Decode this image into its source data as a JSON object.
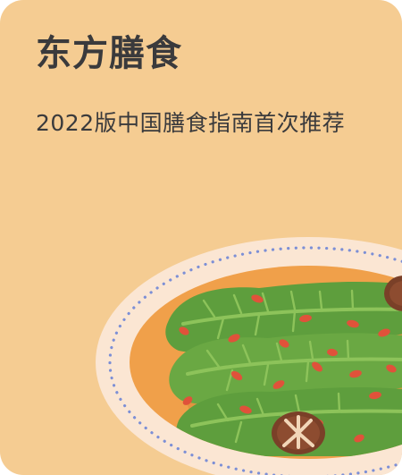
{
  "card": {
    "title": "东方膳食",
    "subtitle": "2022版中国膳食指南首次推荐"
  },
  "illustration": {
    "icon": "vegetable-dish-icon",
    "colors": {
      "background": "#f5cc92",
      "plate": "#fbe6d3",
      "plate_dots": "#7c8fd6",
      "sauce": "#f0a04a",
      "leaf": "#5e9e3d",
      "leaf_light": "#8dc35a",
      "goji": "#e0523a",
      "mushroom": "#7a4028"
    }
  }
}
